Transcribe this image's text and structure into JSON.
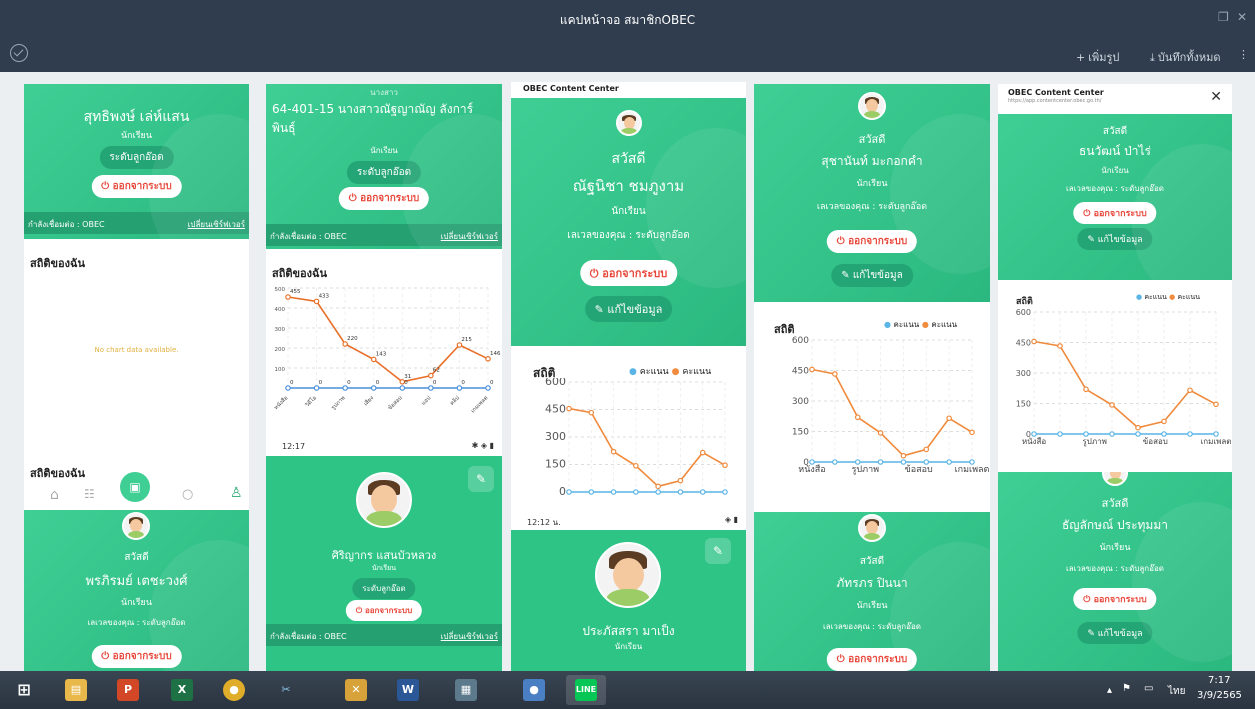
{
  "window": {
    "title": "แคปหน้าจอ สมาชิกOBEC",
    "restore_icon": "restore-icon",
    "close_icon": "close-icon"
  },
  "toolbar": {
    "add_label": "เพิ่มรูป",
    "save_all_label": "บันทึกทั้งหมด"
  },
  "cards": {
    "c1": {
      "name": "สุทธิพงษ์ เล่ห์แสน",
      "role": "นักเรียน",
      "level": "ระดับลูกอ๊อด",
      "logout": "ออกจากระบบ",
      "connect": "กำลังเชื่อมต่อ : OBEC",
      "change_server": "เปลี่ยนเซิร์ฟเวอร์",
      "stat_title": "สถิติของฉัน",
      "no_data": "No chart data available."
    },
    "c1b": {
      "stat_title": "สถิติของฉัน",
      "greet": "สวัสดี",
      "name": "พรภิรมย์ เตชะวงศ์",
      "role": "นักเรียน",
      "level_text": "เลเวลของคุณ : ระดับลูกอ๊อด",
      "logout": "ออกจากระบบ"
    },
    "c2": {
      "prefix": "นางสาว",
      "name": "64-401-15 นางสาวณัฐญาณัญ ลังการ์พินธุ์",
      "role": "นักเรียน",
      "level": "ระดับลูกอ๊อด",
      "logout": "ออกจากระบบ",
      "connect": "กำลังเชื่อมต่อ : OBEC",
      "change_server": "เปลี่ยนเซิร์ฟเวอร์",
      "stat_title": "สถิติของฉัน"
    },
    "c2b": {
      "time": "12:17",
      "name": "ศิริญากร แสนบัวหลวง",
      "role": "นักเรียน",
      "level": "ระดับลูกอ๊อด",
      "logout": "ออกจากระบบ",
      "connect": "กำลังเชื่อมต่อ : OBEC",
      "change_server": "เปลี่ยนเซิร์ฟเวอร์"
    },
    "c3": {
      "header": "OBEC Content Center",
      "greet": "สวัสดี",
      "name": "ณัฐนิชา ชมภูงาม",
      "role": "นักเรียน",
      "level_text": "เลเวลของคุณ : ระดับลูกอ๊อด",
      "logout": "ออกจากระบบ",
      "edit": "แก้ไขข้อมูล",
      "stat_title": "สถิติ",
      "legend_a": "คะแนน",
      "legend_b": "คะแนน"
    },
    "c3b": {
      "time": "12:12 น.",
      "name": "ประภัสสรา มาเป็ง",
      "role": "นักเรียน"
    },
    "c4": {
      "greet": "สวัสดี",
      "name": "สุชานันท์ มะกอกคำ",
      "role": "นักเรียน",
      "level_text": "เลเวลของคุณ : ระดับลูกอ๊อด",
      "logout": "ออกจากระบบ",
      "edit": "แก้ไขข้อมูล",
      "stat_title": "สถิติ",
      "legend_a": "คะแนน",
      "legend_b": "คะแนน"
    },
    "c4b": {
      "greet": "สวัสดี",
      "name": "ภัทรภร ปินนา",
      "role": "นักเรียน",
      "level_text": "เลเวลของคุณ : ระดับลูกอ๊อด",
      "logout": "ออกจากระบบ"
    },
    "c5": {
      "header": "OBEC Content Center",
      "url": "https://app.contentcenter.obec.go.th/",
      "greet": "สวัสดี",
      "name": "ธนวัฒน์ ป่าไร่",
      "role": "นักเรียน",
      "level_text": "เลเวลของคุณ : ระดับลูกอ๊อด",
      "logout": "ออกจากระบบ",
      "edit": "แก้ไขข้อมูล",
      "stat_title": "สถิติ",
      "legend_a": "คะแนน",
      "legend_b": "คะแนน"
    },
    "c5b": {
      "greet": "สวัสดี",
      "name": "ธัญลักษณ์ ประทุมมา",
      "role": "นักเรียน",
      "level_text": "เลเวลของคุณ : ระดับลูกอ๊อด",
      "logout": "ออกจากระบบ",
      "edit": "แก้ไขข้อมูล"
    }
  },
  "chart_data": [
    {
      "type": "line",
      "title": "",
      "categories": [
        "หนังสือ",
        "วิดีโอ",
        "รูปภาพ",
        "เสียง",
        "ข้อสอบ",
        "แอป",
        "คลิป",
        "เกมเพลต"
      ],
      "series": [
        {
          "values": [
            455,
            433,
            220,
            143,
            31,
            62,
            215,
            146
          ],
          "color": "#e8702a"
        },
        {
          "values": [
            0,
            0,
            0,
            0,
            0,
            0,
            0,
            0
          ],
          "color": "#4a90d9"
        }
      ],
      "ylim": [
        0,
        500
      ],
      "yticks": [
        100,
        200,
        300,
        400,
        500
      ],
      "grid": true
    },
    {
      "type": "line",
      "categories": [
        "หนังสือ",
        "รูปภาพ",
        "ข้อสอบ",
        "เกมเพลต"
      ],
      "series": [
        {
          "name": "คะแนน",
          "values": [
            0,
            0,
            0,
            0,
            0,
            0,
            0,
            0
          ],
          "color": "#5ab4e5"
        },
        {
          "name": "คะแนน",
          "values": [
            455,
            433,
            220,
            143,
            31,
            62,
            215,
            146
          ],
          "color": "#f08a3c"
        }
      ],
      "ylim": [
        0,
        600
      ],
      "yticks": [
        0,
        150,
        300,
        450,
        600
      ],
      "grid": true
    }
  ],
  "taskbar": {
    "time": "7:17",
    "date": "3/9/2565",
    "lang": "ไทย"
  },
  "colors": {
    "accent": "#2ec486",
    "dark": "#2f3d4e"
  }
}
